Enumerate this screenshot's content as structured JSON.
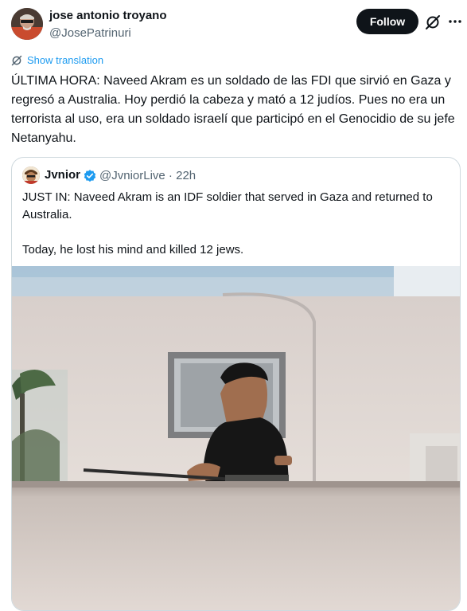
{
  "tweet": {
    "author_name": "jose antonio troyano",
    "author_handle": "@JosePatrinuri",
    "follow_label": "Follow",
    "show_translation": "Show translation",
    "text": "ÚLTIMA HORA: Naveed Akram es un soldado de las FDI que sirvió en Gaza y regresó a Australia.  Hoy perdió la cabeza y mató a 12 judíos. Pues no era un terrorista al uso, era un soldado israelí que participó en el Genocidio de su jefe Netanyahu."
  },
  "quoted": {
    "name": "Jvnior",
    "handle": "@JvniorLive",
    "time": "22h",
    "paragraph_1": "JUST IN: Naveed Akram is an IDF soldier that served in Gaza and returned to Australia.",
    "paragraph_2": "Today, he lost his mind and killed 12 jews."
  },
  "icons": {
    "more": "more-icon",
    "grok": "grok-icon",
    "translate": "translate-icon",
    "verified": "verified-badge-icon"
  },
  "colors": {
    "accent": "#1d9bf0",
    "text_primary": "#0f1419",
    "text_secondary": "#536471",
    "border": "#cfd9de",
    "follow_bg": "#0f1419"
  }
}
